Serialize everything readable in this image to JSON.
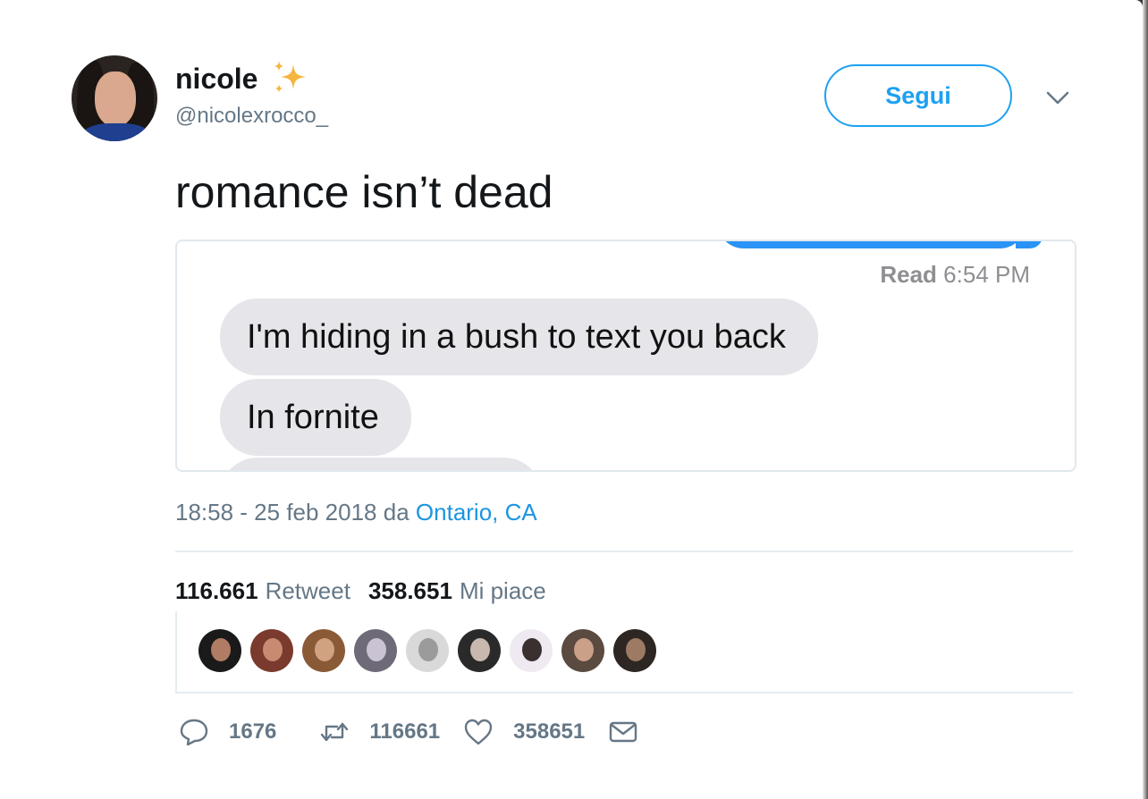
{
  "tweet": {
    "author_name": "nicole",
    "author_handle": "@nicolexrocco_",
    "follow_label": "Segui",
    "text": "romance isn’t dead",
    "timestamp": "18:58 - 25 feb 2018 da",
    "location": "Ontario, CA"
  },
  "media": {
    "read_label": "Read",
    "read_time": "6:54 PM",
    "messages": [
      "I'm hiding in a bush to text you back",
      "In fornite"
    ]
  },
  "stats": {
    "retweets_count": "116.661",
    "retweets_label": "Retweet",
    "likes_count": "358.651",
    "likes_label": "Mi piace"
  },
  "likers": [
    {
      "icon": "avatar",
      "color": "#1a1a1a",
      "face": "#b07c64"
    },
    {
      "icon": "avatar",
      "color": "#7a3a2e",
      "face": "#c98a72"
    },
    {
      "icon": "avatar",
      "color": "#8a5a36",
      "face": "#d1a282"
    },
    {
      "icon": "avatar",
      "color": "#6e6a78",
      "face": "#c9c3d4"
    },
    {
      "icon": "avatar",
      "color": "#d9d9d9",
      "face": "#9b9b9b"
    },
    {
      "icon": "avatar",
      "color": "#2a2a2a",
      "face": "#c9b8ae"
    },
    {
      "icon": "avatar",
      "color": "#efeaf2",
      "face": "#3a3030"
    },
    {
      "icon": "avatar",
      "color": "#5a4a40",
      "face": "#caa088"
    },
    {
      "icon": "avatar",
      "color": "#2e2622",
      "face": "#9c7a64"
    }
  ],
  "actions": {
    "replies": "1676",
    "retweets": "116661",
    "likes": "358651"
  },
  "colors": {
    "accent": "#1da1f2",
    "link": "#1b95e0",
    "muted": "#657786",
    "imessage_blue": "#2a93f5",
    "imessage_gray": "#e5e5ea"
  }
}
